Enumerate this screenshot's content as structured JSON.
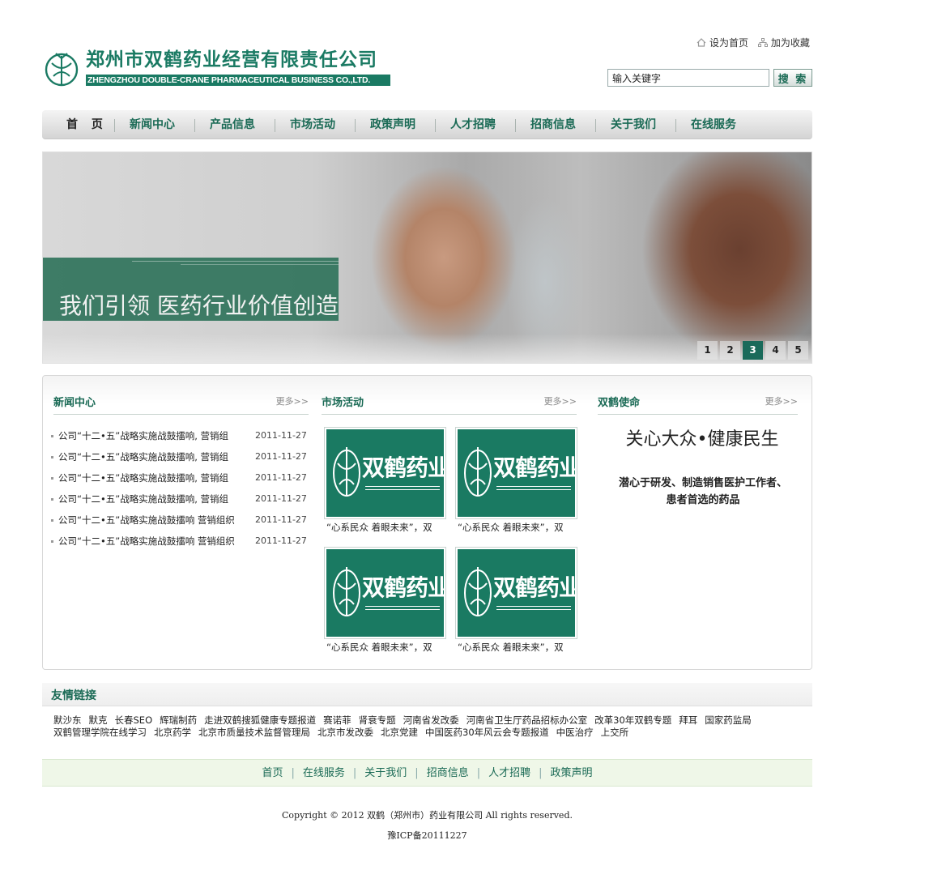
{
  "header": {
    "company_cn": "郑州市双鹤药业经营有限责任公司",
    "company_en": "ZHENGZHOU DOUBLE-CRANE PHARMACEUTICAL BUSINESS CO.,LTD.",
    "set_home": "设为首页",
    "add_favorite": "加为收藏",
    "search_value": "输入关键字",
    "search_button": "搜 索"
  },
  "nav": [
    {
      "label": "首 页"
    },
    {
      "label": "新闻中心"
    },
    {
      "label": "产品信息"
    },
    {
      "label": "市场活动"
    },
    {
      "label": "政策声明"
    },
    {
      "label": "人才招聘"
    },
    {
      "label": "招商信息"
    },
    {
      "label": "关于我们"
    },
    {
      "label": "在线服务"
    }
  ],
  "banner": {
    "caption": "我们引领  医药行业价值创造",
    "pages": [
      "1",
      "2",
      "3",
      "4",
      "5"
    ],
    "active_page": "3"
  },
  "news": {
    "title": "新闻中心",
    "more": "更多>>",
    "items": [
      {
        "title": "公司“十二•五”战略实施战鼓擂响, 营销组",
        "date": "2011-11-27"
      },
      {
        "title": "公司“十二•五”战略实施战鼓擂响, 营销组",
        "date": "2011-11-27"
      },
      {
        "title": "公司“十二•五”战略实施战鼓擂响, 营销组",
        "date": "2011-11-27"
      },
      {
        "title": "公司“十二•五”战略实施战鼓擂响, 营销组",
        "date": "2011-11-27"
      },
      {
        "title": "公司“十二•五”战略实施战鼓擂响 营销组织",
        "date": "2011-11-27"
      },
      {
        "title": "公司“十二•五”战略实施战鼓擂响 营销组织",
        "date": "2011-11-27"
      }
    ]
  },
  "market": {
    "title": "市场活动",
    "more": "更多>>",
    "items": [
      {
        "brand": "双鹤药业",
        "caption": "“心系民众 着眼未来”，双"
      },
      {
        "brand": "双鹤药业",
        "caption": "“心系民众 着眼未来”，双"
      },
      {
        "brand": "双鹤药业",
        "caption": "“心系民众 着眼未来”，双"
      },
      {
        "brand": "双鹤药业",
        "caption": "“心系民众 着眼未来”，双"
      }
    ]
  },
  "mission": {
    "title": "双鹤使命",
    "more": "更多>>",
    "headline": "关心大众•健康民生",
    "line1": "潜心于研发、制造销售医护工作者、",
    "line2": "患者首选的药品"
  },
  "links": {
    "title": "友情链接",
    "items": [
      "默沙东",
      "默克",
      "长春SEO",
      "辉瑞制药",
      "走进双鹤搜狐健康专题报道",
      "赛诺菲",
      "肾衰专题",
      "河南省发改委",
      "河南省卫生厅药品招标办公室",
      "改革30年双鹤专题",
      "拜耳",
      "国家药监局",
      "双鹤管理学院在线学习",
      "北京药学",
      "北京市质量技术监督管理局",
      "北京市发改委",
      "北京党建",
      "中国医药30年风云会专题报道",
      "中医治疗",
      "上交所"
    ]
  },
  "footer": {
    "nav": [
      "首页",
      "在线服务",
      "关于我们",
      "招商信息",
      "人才招聘",
      "政策声明"
    ],
    "copyright": "Copyright © 2012 双鹤（郑州市）药业有限公司 All rights reserved.",
    "icp": "豫ICP备20111227"
  },
  "colors": {
    "brand_green": "#1a7a63",
    "nav_text": "#1a6a55",
    "footer_bg": "#eff7e8"
  }
}
